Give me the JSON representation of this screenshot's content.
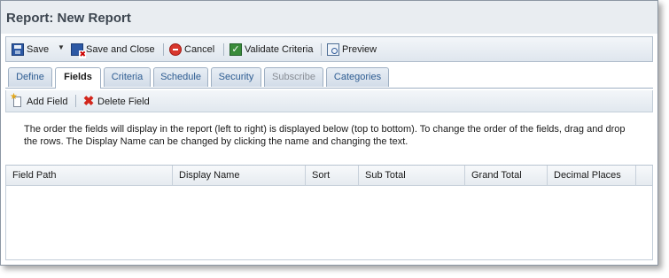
{
  "window": {
    "title": "Report: New Report"
  },
  "toolbar": {
    "save_label": "Save",
    "save_close_label": "Save and Close",
    "cancel_label": "Cancel",
    "validate_label": "Validate Criteria",
    "preview_label": "Preview"
  },
  "tabs": [
    {
      "label": "Define",
      "state": "normal"
    },
    {
      "label": "Fields",
      "state": "active"
    },
    {
      "label": "Criteria",
      "state": "normal"
    },
    {
      "label": "Schedule",
      "state": "normal"
    },
    {
      "label": "Security",
      "state": "normal"
    },
    {
      "label": "Subscribe",
      "state": "disabled"
    },
    {
      "label": "Categories",
      "state": "normal"
    }
  ],
  "fields_toolbar": {
    "add_label": "Add Field",
    "delete_label": "Delete Field"
  },
  "instructions": {
    "line1": "The order the fields will display in the report (left to right) is displayed below (top to bottom). To change the order of the fields, drag and drop",
    "line2": "the rows. The Display Name can be changed by clicking the name and changing the text."
  },
  "grid": {
    "columns": [
      "Field Path",
      "Display Name",
      "Sort",
      "Sub Total",
      "Grand Total",
      "Decimal Places"
    ],
    "rows": []
  }
}
